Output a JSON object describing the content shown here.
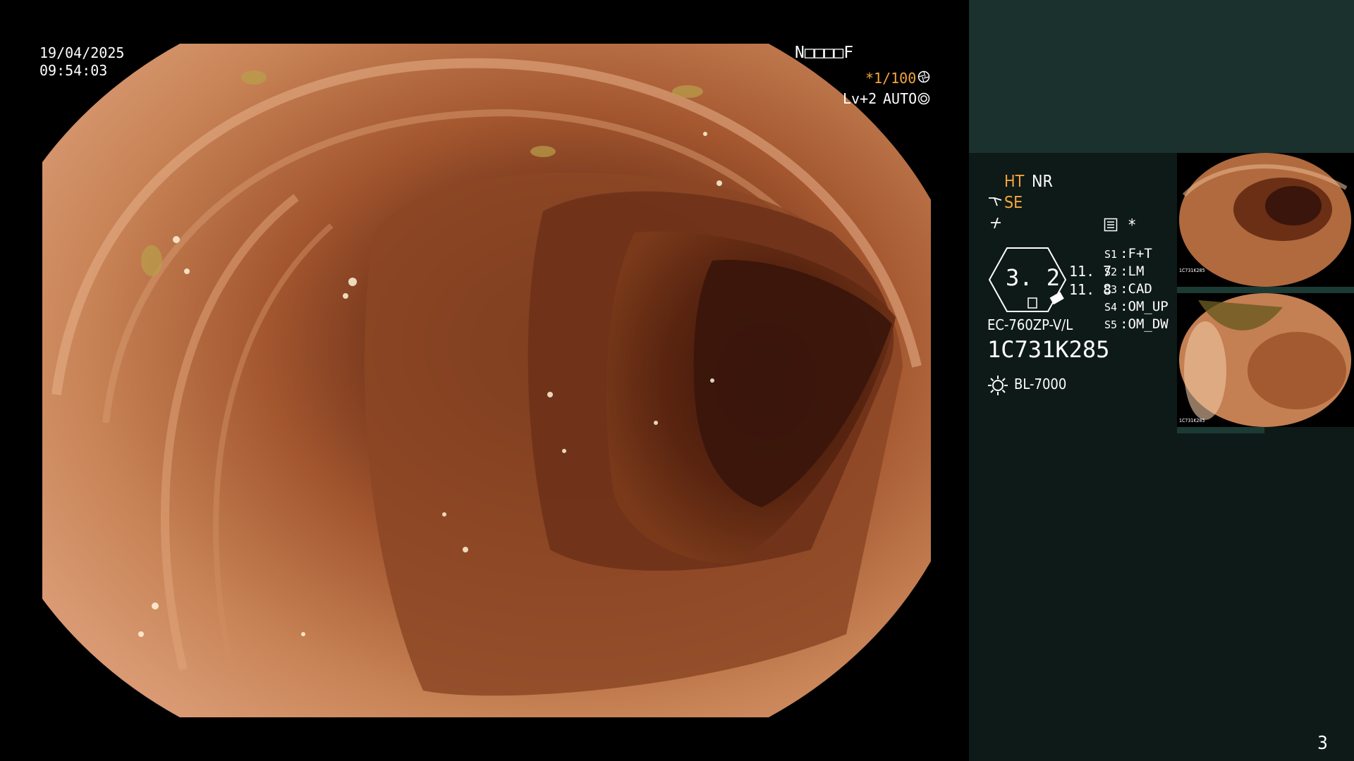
{
  "viewer": {
    "date": "19/04/2025",
    "time": "09:54:03",
    "patient_code": "N□□□□F",
    "shutter": "*1/100",
    "level": "Lv+2",
    "iris": "AUTO",
    "shutter_icon": "aperture-icon",
    "iris_icon": "auto-iris-icon"
  },
  "panel": {
    "ht": "HT",
    "nr": "NR",
    "se": "SE",
    "se_icon": "scope-angle-icon",
    "freeze_icon": "freeze-icon",
    "record_icon": "record-icon",
    "asterisk": "*",
    "scope_diameter": "3. 2",
    "value_top": "11. 7",
    "value_bottom": "11. 8",
    "scope_model": "EC-760ZP-V/L",
    "scope_serial": "1C731K285",
    "light_source": "BL-7000",
    "light_icon": "light-source-icon",
    "scenes": [
      {
        "key": "S1",
        "value": "F+T"
      },
      {
        "key": "S2",
        "value": "LM"
      },
      {
        "key": "S3",
        "value": "CAD"
      },
      {
        "key": "S4",
        "value": "OM_UP"
      },
      {
        "key": "S5",
        "value": "OM_DW"
      }
    ],
    "thumbnails": [
      {
        "label": "captured image 1"
      },
      {
        "label": "captured image 2"
      }
    ],
    "page_number": "3"
  },
  "colors": {
    "background": "#000000",
    "panel_top": "#1b312d",
    "panel_main": "#0e1a18",
    "accent": "#f5a53a",
    "text": "#ffffff"
  }
}
